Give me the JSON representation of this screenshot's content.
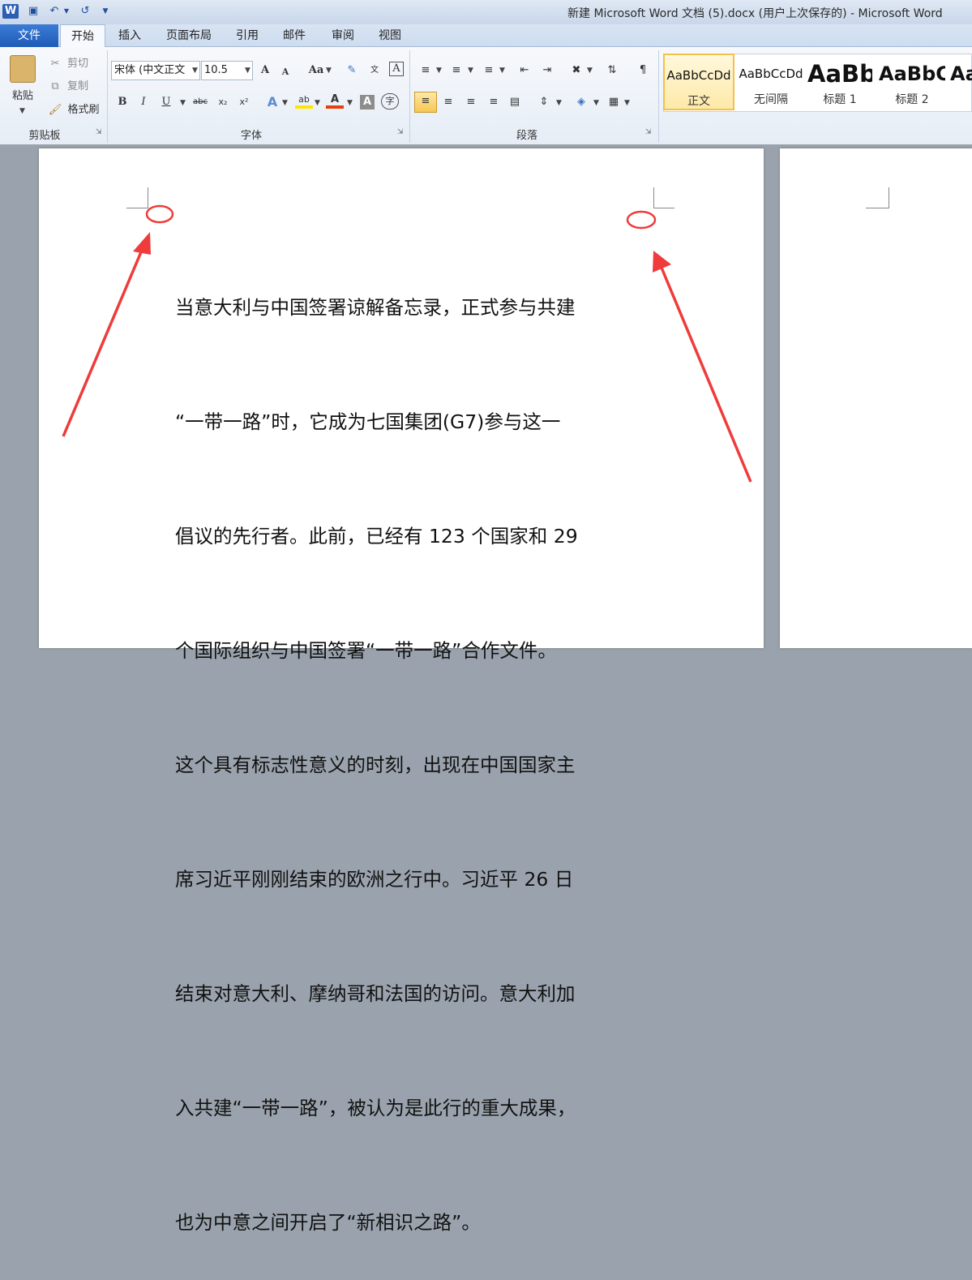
{
  "window": {
    "title": "新建 Microsoft Word 文档 (5).docx (用户上次保存的) - Microsoft Word"
  },
  "quick_access": {
    "save_icon": "save-icon",
    "undo_icon": "undo-icon",
    "redo_icon": "redo-icon"
  },
  "tabs": [
    {
      "label": "文件",
      "active": false
    },
    {
      "label": "开始",
      "active": true
    },
    {
      "label": "插入",
      "active": false
    },
    {
      "label": "页面布局",
      "active": false
    },
    {
      "label": "引用",
      "active": false
    },
    {
      "label": "邮件",
      "active": false
    },
    {
      "label": "审阅",
      "active": false
    },
    {
      "label": "视图",
      "active": false
    }
  ],
  "clipboard": {
    "paste_label": "粘贴",
    "cut_label": "剪切",
    "copy_label": "复制",
    "format_painter_label": "格式刷",
    "group_label": "剪贴板"
  },
  "font": {
    "font_name": "宋体 (中文正文",
    "font_size": "10.5",
    "grow_label": "A",
    "shrink_label": "A",
    "change_case_label": "Aa",
    "bold": "B",
    "italic": "I",
    "underline": "U",
    "strike": "abc",
    "subscript": "x₂",
    "superscript": "x²",
    "text_effect": "A",
    "highlight": "ab",
    "font_color": "A",
    "char_shading": "A",
    "enclosed": "字",
    "group_label": "字体"
  },
  "paragraph": {
    "group_label": "段落"
  },
  "styles": [
    {
      "sample": "AaBbCcDd",
      "name": "正文",
      "selected": true
    },
    {
      "sample": "AaBbCcDd",
      "name": "无间隔",
      "selected": false
    },
    {
      "sample": "AaBb",
      "name": "标题 1",
      "selected": false
    },
    {
      "sample": "AaBbC",
      "name": "标题 2",
      "selected": false
    },
    {
      "sample": "Aa",
      "name": "",
      "selected": false
    }
  ],
  "document": {
    "lines": [
      "当意大利与中国签署谅解备忘录，正式参与共建",
      "“一带一路”时，它成为七国集团(G7)参与这一",
      "倡议的先行者。此前，已经有 123 个国家和 29",
      "个国际组织与中国签署“一带一路”合作文件。",
      "这个具有标志性意义的时刻，出现在中国国家主",
      "席习近平刚刚结束的欧洲之行中。习近平 26 日",
      "结束对意大利、摩纳哥和法国的访问。意大利加",
      "入共建“一带一路”，被认为是此行的重大成果，",
      "也为中意之间开启了“新相识之路”。"
    ]
  },
  "colors": {
    "accent": "#1f5bb8",
    "annotation": "#ef3b3b",
    "selected_style": "#f3c04a"
  }
}
